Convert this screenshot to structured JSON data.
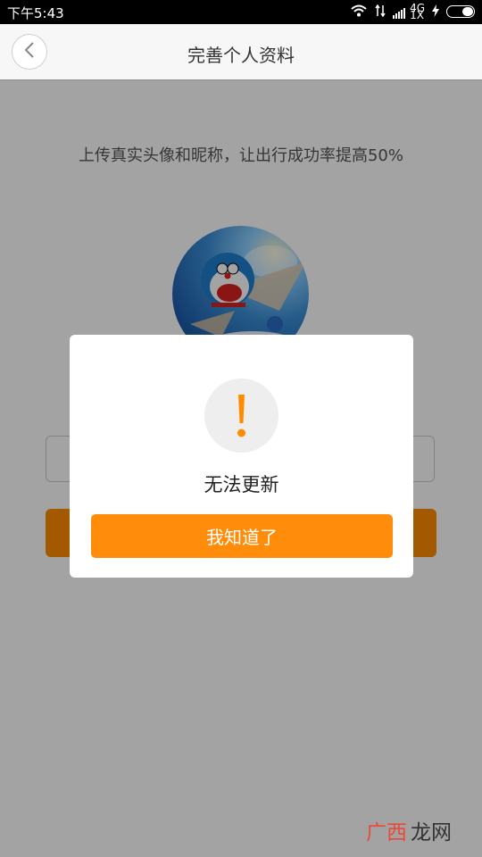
{
  "status_bar": {
    "time": "下午5:43",
    "network_label": "4G",
    "signal_label": "1X"
  },
  "header": {
    "title": "完善个人资料",
    "back_icon": "chevron-left-icon"
  },
  "main": {
    "hint": "上传真实头像和昵称，让出行成功率提高50%",
    "avatar_icon": "cartoon-avatar-image"
  },
  "dialog": {
    "icon": "exclamation-icon",
    "message": "无法更新",
    "confirm_label": "我知道了"
  },
  "watermark": {
    "text": "广西龙网"
  },
  "colors": {
    "accent": "#ff8c00",
    "overlay": "#000000",
    "dialog_bg": "#ffffff"
  }
}
